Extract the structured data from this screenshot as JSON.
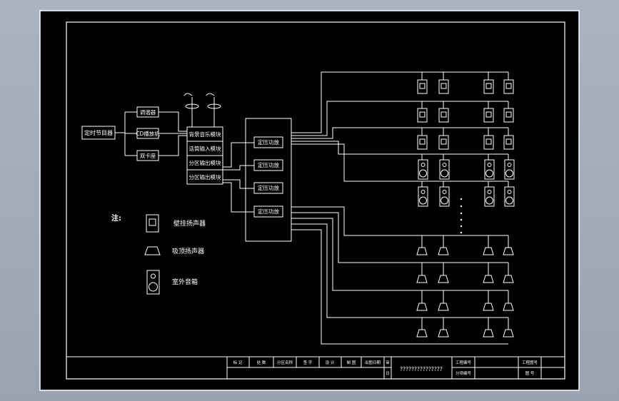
{
  "blocks": {
    "timer": "定时节目器",
    "tuner": "调谐器",
    "cd": "CD播放机",
    "tape": "双卡座",
    "bg_music": "背景音乐模块",
    "voice_in": "话筒输入模块",
    "out1": "分区输出模块",
    "out2": "分区输出模块"
  },
  "amps": [
    "定压功放",
    "定压功放",
    "定压功放",
    "定压功放"
  ],
  "legend": {
    "note": "注:",
    "wall": "壁挂扬声器",
    "ceiling": "吸顶扬声器",
    "outdoor": "室外音箱"
  },
  "title_block": {
    "c1": "标 记",
    "c2": "处 数",
    "c3": "分区名称",
    "c4": "签 字",
    "c5": "设 计",
    "c6": "制 图",
    "c7": "出图日期",
    "c8": "审",
    "c9": "日",
    "project": "???????????????",
    "eng_no": "工程编号",
    "item_no": "分项编号",
    "drawing": "工程图号",
    "sheet": "图 号"
  },
  "colors": {
    "background": "#000000",
    "line": "#ffffff",
    "frame": "#a6afbb"
  }
}
